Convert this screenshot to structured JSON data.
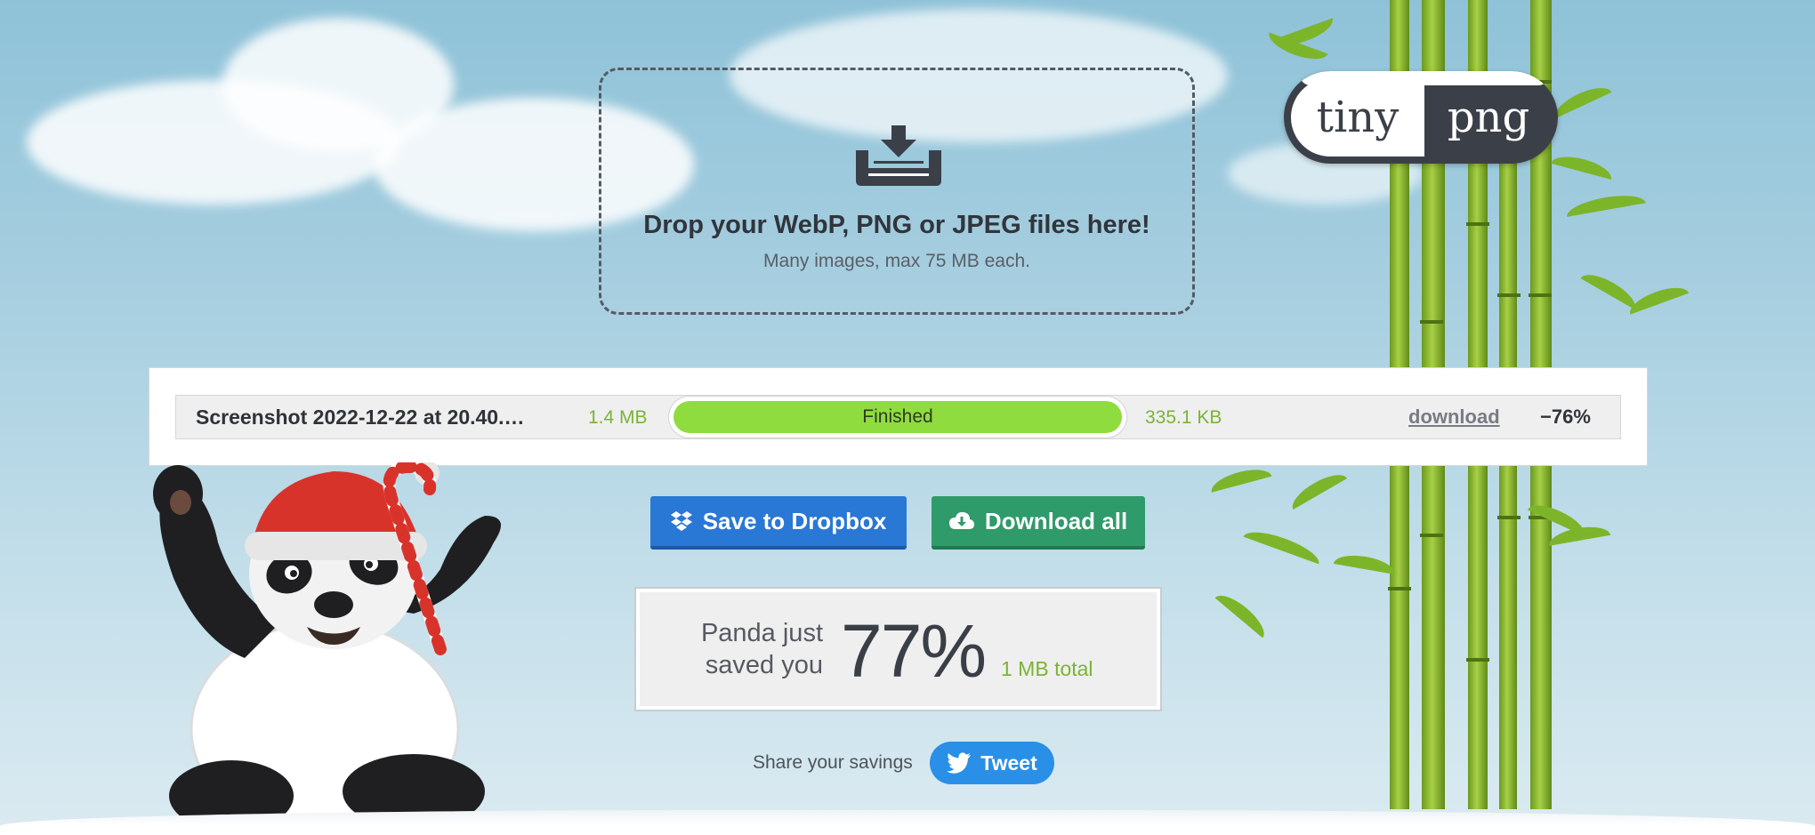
{
  "app": {
    "logo_left": "tiny",
    "logo_right": "png"
  },
  "dropzone": {
    "icon": "download-tray-icon",
    "title": "Drop your WebP, PNG or JPEG files here!",
    "subtitle": "Many images, max 75 MB each."
  },
  "results": [
    {
      "filename": "Screenshot 2022-12-22 at 20.40.…",
      "original_size": "1.4 MB",
      "status": "Finished",
      "progress": 1.0,
      "new_size": "335.1 KB",
      "download_label": "download",
      "reduction": "−76%"
    }
  ],
  "actions": {
    "dropbox_label": "Save to Dropbox",
    "dropbox_icon": "dropbox-icon",
    "download_all_label": "Download all",
    "download_all_icon": "cloud-download-icon"
  },
  "savings": {
    "line1": "Panda just",
    "line2": "saved you",
    "percent": "77%",
    "total": "1 MB total"
  },
  "share": {
    "label": "Share your savings",
    "tweet_label": "Tweet",
    "tweet_icon": "twitter-bird-icon"
  },
  "colors": {
    "accent_green": "#8fdc3f",
    "size_green": "#7ab435",
    "dropbox_blue": "#2a78d5",
    "download_green": "#2f9a6a",
    "twitter_blue": "#2a8fe6",
    "dark_text": "#2f3338"
  }
}
